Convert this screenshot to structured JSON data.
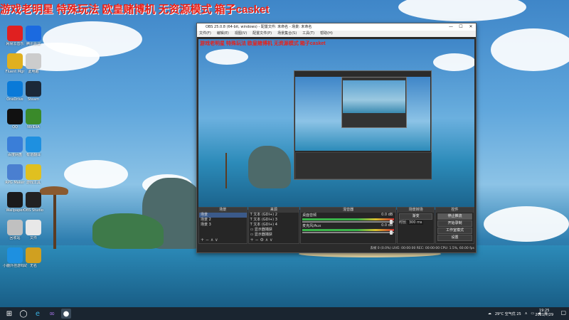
{
  "banner": {
    "text": "游戏老明星  特殊玩法  欧皇赌博机  无资源模式  箱子casket"
  },
  "desktop_icons": [
    {
      "label": "网易云音乐",
      "icon": "netease-music-icon",
      "color": "#e02020"
    },
    {
      "label": "腾讯会议",
      "icon": "camera-icon",
      "color": "#1b6ae0"
    },
    {
      "label": "Fluent Mgr",
      "icon": "folder-icon",
      "color": "#e0b020"
    },
    {
      "label": "此电脑",
      "icon": "computer-icon",
      "color": "#cccccc"
    },
    {
      "label": "OneDrive",
      "icon": "onedrive-icon",
      "color": "#0a7ad8"
    },
    {
      "label": "Steam",
      "icon": "steam-icon",
      "color": "#1b2838"
    },
    {
      "label": "QQ",
      "icon": "qq-icon",
      "color": "#111111"
    },
    {
      "label": "NVIDIA",
      "icon": "nvidia-icon",
      "color": "#3a8a2a"
    },
    {
      "label": "百度网盘",
      "icon": "cloud-icon",
      "color": "#3a7ed8"
    },
    {
      "label": "有道翻译",
      "icon": "translate-icon",
      "color": "#1e90e0"
    },
    {
      "label": "RPG Maker",
      "icon": "game-icon",
      "color": "#4a7fd0"
    },
    {
      "label": "游戏工具",
      "icon": "game-icon",
      "color": "#e0c020"
    },
    {
      "label": "Wallpaper",
      "icon": "wallpaper-icon",
      "color": "#1a1a1a"
    },
    {
      "label": "OBS Studio",
      "icon": "obs-icon",
      "color": "#222222"
    },
    {
      "label": "回收站",
      "icon": "recycle-bin-icon",
      "color": "#c0c0c0"
    },
    {
      "label": "文件",
      "icon": "file-icon",
      "color": "#e8e8e8"
    },
    {
      "label": "小鹿外挂游戏助手",
      "icon": "globe-icon",
      "color": "#1e90e0"
    },
    {
      "label": "无名",
      "icon": "file-icon",
      "color": "#d0a020"
    }
  ],
  "obs": {
    "title": "OBS 25.0.8 (64-bit, windows) - 配置文件: 未命名 - 场景: 未命名",
    "minimize": "—",
    "maximize": "☐",
    "close": "✕",
    "menu": [
      "文件(F)",
      "编辑(E)",
      "视图(V)",
      "配置文件(P)",
      "场景集合(S)",
      "工具(T)",
      "帮助(H)"
    ],
    "preview_banner": "游戏老明星  特殊玩法  欧皇赌博机  无资源模式  箱子casket",
    "scenes": {
      "header": "场景",
      "items": [
        "场景",
        "场景 2",
        "场景 3"
      ]
    },
    "sources": {
      "header": "来源",
      "items": [
        "文本 (GDI+) 2",
        "文本 (GDI+) 3",
        "文本 (GDI+) 4",
        "显示器捕获",
        "显示器捕获"
      ]
    },
    "mixer": {
      "header": "混音器",
      "channels": [
        {
          "name": "桌面音频",
          "level": "0.0 dB"
        },
        {
          "name": "麦克风/Aux",
          "level": "0.0 dB"
        }
      ]
    },
    "transitions": {
      "header": "场景转场",
      "type": "渐变",
      "duration_label": "时长",
      "duration": "300 ms"
    },
    "controls": {
      "header": "控件",
      "buttons": [
        "停止推流",
        "开始录制",
        "工作室模式",
        "设置",
        "退出"
      ]
    },
    "status": "丢帧 0 (0.0%)    LIVE: 00:00:00    REC: 00:00:00    CPU: 1.5%, 60.00 fps"
  },
  "taskbar": {
    "weather": "29°C 空气优 25",
    "time": "19:25",
    "date": "2021/7/29"
  }
}
